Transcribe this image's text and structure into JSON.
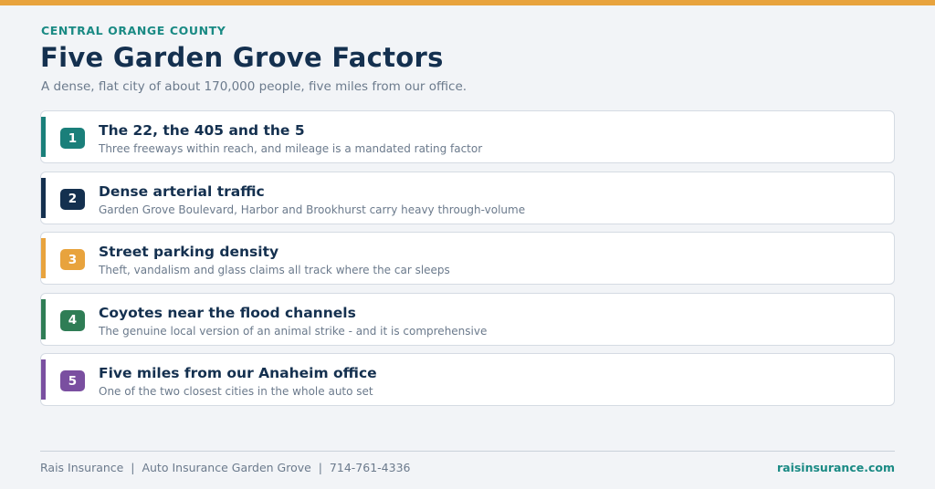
{
  "header": {
    "eyebrow": "CENTRAL ORANGE COUNTY",
    "title": "Five Garden Grove Factors",
    "subtitle": "A dense, flat city of about 170,000 people, five miles from our office."
  },
  "factors": [
    {
      "number": "1",
      "title": "The 22, the 405 and the 5",
      "description": "Three freeways within reach, and mileage is a mandated rating factor",
      "color": "#1a7f7a"
    },
    {
      "number": "2",
      "title": "Dense arterial traffic",
      "description": "Garden Grove Boulevard, Harbor and Brookhurst carry heavy through-volume",
      "color": "#14304f"
    },
    {
      "number": "3",
      "title": "Street parking density",
      "description": "Theft, vandalism and glass claims all track where the car sleeps",
      "color": "#e8a33d"
    },
    {
      "number": "4",
      "title": "Coyotes near the flood channels",
      "description": "The genuine local version of an animal strike - and it is comprehensive",
      "color": "#2f7d55"
    },
    {
      "number": "5",
      "title": "Five miles from our Anaheim office",
      "description": "One of the two closest cities in the whole auto set",
      "color": "#7a4fa0"
    }
  ],
  "footer": {
    "left": "Rais Insurance  |  Auto Insurance Garden Grove  |  714-761-4336",
    "right": "raisinsurance.com"
  },
  "colors": {
    "accent_bar": "#e8a33d",
    "eyebrow": "#1a8a84",
    "title": "#14304f"
  }
}
